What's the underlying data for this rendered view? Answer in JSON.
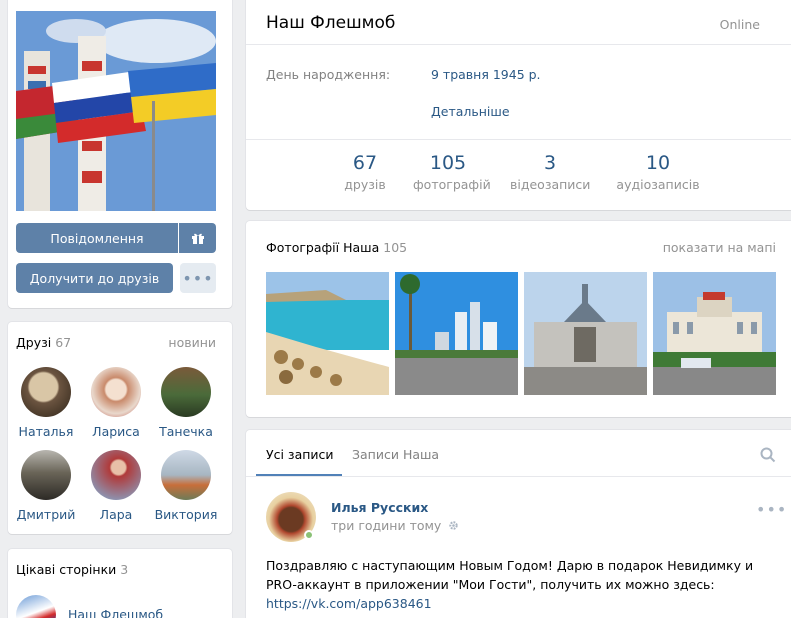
{
  "profile": {
    "name": "Наш Флешмоб",
    "status": "Online",
    "birthday_label": "День народження:",
    "birthday_value": "9 травня 1945 р.",
    "details_link": "Детальніше",
    "counters": [
      {
        "num": "67",
        "label": "друзів"
      },
      {
        "num": "105",
        "label": "фотографій"
      },
      {
        "num": "3",
        "label": "відеозаписи"
      },
      {
        "num": "10",
        "label": "аудіозаписів"
      }
    ]
  },
  "actions": {
    "message": "Повідомлення",
    "add_friend": "Долучити до друзів",
    "more": "•••"
  },
  "friends": {
    "title": "Друзі",
    "count": "67",
    "news_link": "новини",
    "items": [
      {
        "name": "Наталья"
      },
      {
        "name": "Лариса"
      },
      {
        "name": "Танечка"
      },
      {
        "name": "Дмитрий"
      },
      {
        "name": "Лара"
      },
      {
        "name": "Виктория"
      }
    ]
  },
  "pages": {
    "title": "Цікаві сторінки",
    "count": "3",
    "first_item": "Наш Флешмоб"
  },
  "photos": {
    "title": "Фотографії Наша",
    "count": "105",
    "map_link": "показати на мапі"
  },
  "wall": {
    "tabs": [
      "Усі записи",
      "Записи Наша"
    ],
    "post": {
      "author": "Илья Русских",
      "time": "три години тому",
      "text": "Поздравляю с наступающим Новым Годом! Дарю в подарок Невидимку и PRO-аккаунт в приложении \"Мои Гости\", получить их можно здесь: ",
      "link": "https://vk.com/app638461",
      "more": "•••"
    }
  },
  "colors": {
    "link": "#2a5885",
    "button": "#5e81a8",
    "background": "#edeef0",
    "online": "#8ac176"
  },
  "icons": [
    "gift-icon",
    "search-icon",
    "gear-icon",
    "more-icon"
  ]
}
